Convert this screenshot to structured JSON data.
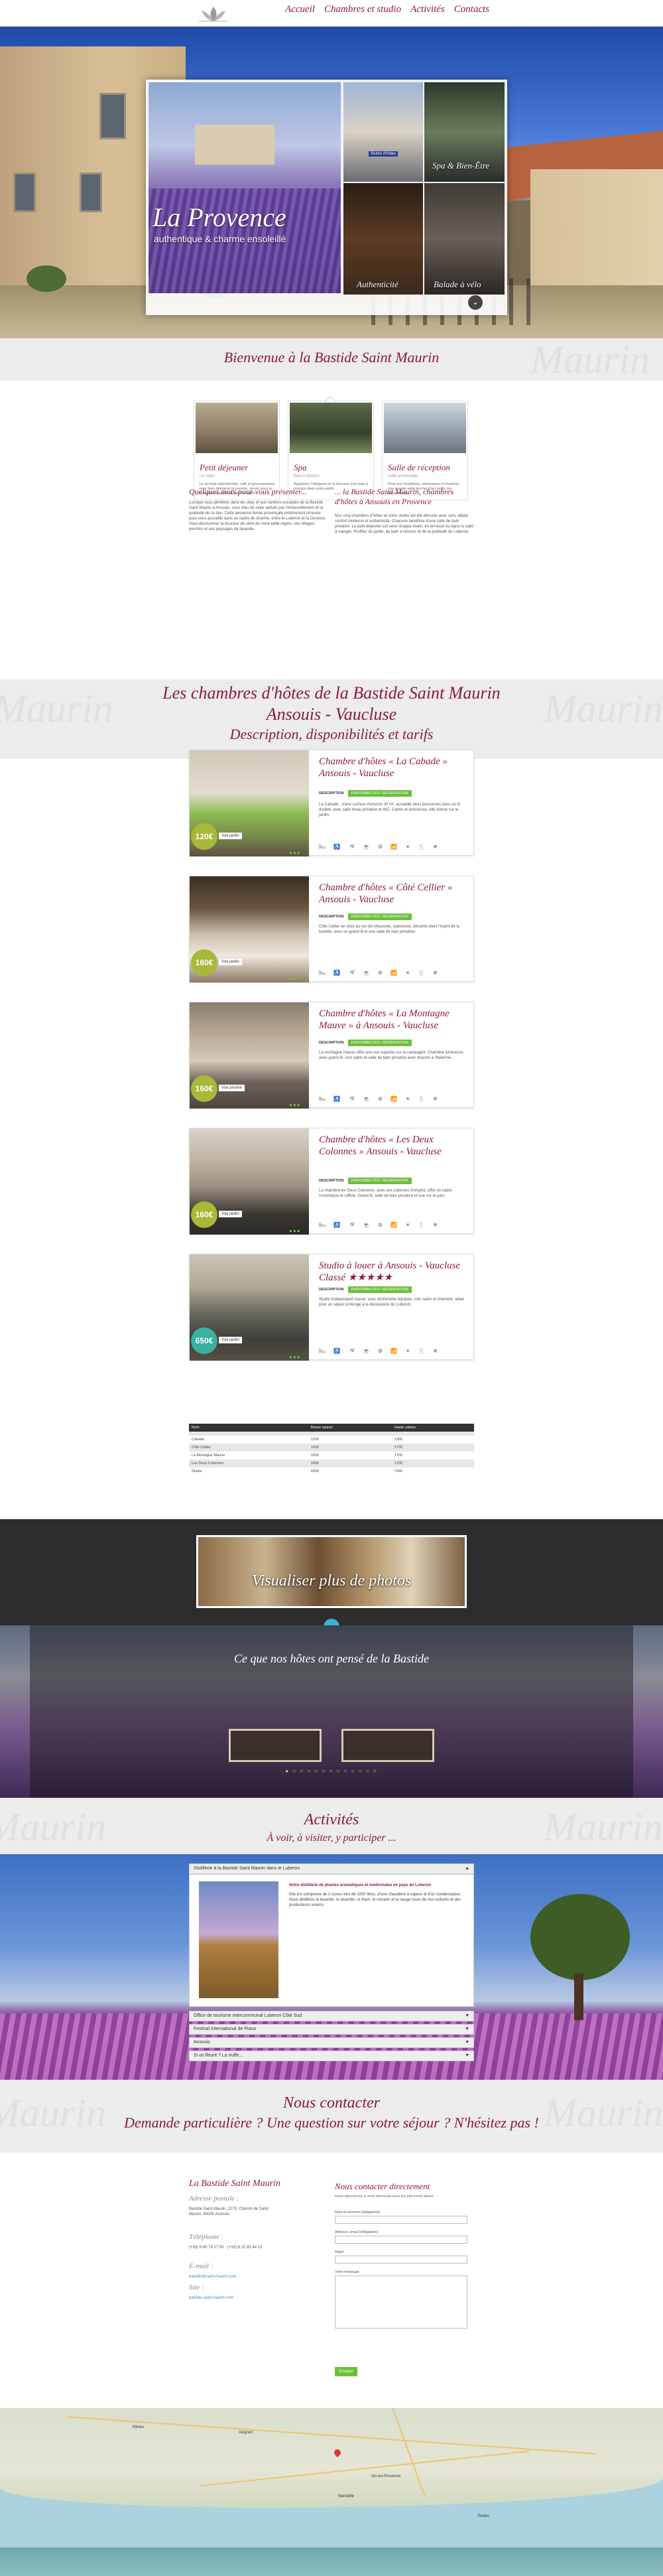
{
  "nav": {
    "items": [
      "Accueil",
      "Chambres et studio",
      "Activités",
      "Contacts"
    ]
  },
  "hero": {
    "title": "La Provence",
    "subtitle": "authentique & charme ensoleillé",
    "thumb1_tag": "Studio d'hôtes",
    "thumb2_label": "Spa & Bien-Être",
    "thumb3_label": "Authenticité",
    "thumb4_label": "Balade à vélo"
  },
  "welcome": {
    "title": "Bienvenue à la Bastide Saint Maurin",
    "watermark": "Maurin"
  },
  "services": [
    {
      "title": "Petit déjeuner",
      "sub": "Le matin",
      "desc": "Le du frais sélectionnés, café et gourmandises pour bien démarrer la journée, servis sous la tonnelle du jardin ou dans le salon."
    },
    {
      "title": "Spa",
      "sub": "Bain à remous",
      "desc": "Appréciez l'élégance et la douceur d'un bain à remous dans notre jardin."
    },
    {
      "title": "Salle de réception",
      "sub": "Salle privatisable",
      "desc": "Pour vos réceptions, séminaires et réunions, une grande salle permet d'accueillir vos évènements."
    }
  ],
  "intro": {
    "left_title": "Quelques mots pour vous présenter...",
    "left_text": "Lorsque vous pénétrez dans les sites et aux sentiers escarpés de la Bastide Saint Maurin à Ansouis, vous êtes de suite séduits par l'émerveillement et la quiétude de ce lieu. Cette ancienne ferme provençale entièrement rénovée pour vous accueillir dans un cadre de charme, entre le Luberon et la Durance. Vous découvrirez la douceur de vivre de notre belle région, ses villages perchés et ses paysages de lavande.",
    "right_title": "... la Bastide Saint Maurin, chambres d'hôtes à Ansouis en Provence",
    "right_text": "Nos cinq chambres d'hôtes et notre studio ont été décorés avec soin, alliant confort moderne et authenticité. Chacune bénéficie d'une salle de bain privative. Le petit déjeuner est servi chaque matin, en terrasse ou dans la salle à manger. Profitez du jardin, du bain à remous et de la quiétude du Luberon."
  },
  "rooms_band": {
    "line1": "Les chambres d'hôtes de la Bastide Saint Maurin",
    "line2": "Ansouis - Vaucluse",
    "line3": "Description, disponibilités et tarifs"
  },
  "rooms": [
    {
      "title": "Chambre d'hôtes « La Cabade » Ansouis - Vaucluse",
      "price": "120€",
      "caption": "Vue jardin",
      "desc_label": "DESCRIPTION",
      "dispo_label": "DISPONIBILITÉS / RÉSERVATION",
      "desc": "La Cabade : d'une surface d'environ 20 m², accueille deux personnes dans un lit double, avec salle d'eau privative et WC. Calme et lumineuse, elle donne sur le jardin."
    },
    {
      "title": "Chambre d'hôtes « Côté Cellier » Ansouis - Vaucluse",
      "price": "160€",
      "caption": "Vue jardin",
      "desc_label": "DESCRIPTION",
      "dispo_label": "DISPONIBILITÉS / RÉSERVATION",
      "desc": "Côté Cellier se situe au rez-de-chaussée, spacieuse, décorée dans l'esprit de la bastide, avec un grand lit et une salle de bain privative."
    },
    {
      "title": "Chambre d'hôtes « La Montagne Mauve » à Ansouis - Vaucluse",
      "price": "160€",
      "caption": "Vue piscine",
      "desc_label": "DESCRIPTION",
      "dispo_label": "DISPONIBILITÉS / RÉSERVATION",
      "desc": "La montagne mauve offre une vue superbe sur la campagne. Chambre lumineuse avec grand lit, coin salon et salle de bain privative avec douche à l'italienne."
    },
    {
      "title": "Chambre d'hôtes « Les Deux Colonnes » Ansouis - Vaucluse",
      "price": "160€",
      "caption": "Vue jardin",
      "desc_label": "DESCRIPTION",
      "dispo_label": "DISPONIBILITÉS / RÉSERVATION",
      "desc": "La chambre les Deux Colonnes, avec ses colonnes d'origine, offre un cadre romantique et raffiné. Grand lit, salle de bain privative et vue sur le parc."
    },
    {
      "title": "Studio à louer à Ansouis - Vaucluse Classé ★★★★★",
      "price": "650€",
      "caption": "Vue jardin",
      "desc_label": "DESCRIPTION",
      "dispo_label": "DISPONIBILITÉS / RÉSERVATION",
      "desc": "Studio indépendant classé, avec kitchenette équipée, coin salon et chambre. Idéal pour un séjour prolongé à la découverte du Luberon."
    }
  ],
  "tarifs": {
    "headers": [
      "Nom",
      "Basse saison",
      "Haute saison"
    ],
    "rows": [
      [
        "",
        "",
        ""
      ],
      [
        "Cabade",
        "120€",
        "130€"
      ],
      [
        "Côté Cellier",
        "160€",
        "170€"
      ],
      [
        "La Montagne Mauve",
        "160€",
        "170€"
      ],
      [
        "Les Deux Colonnes",
        "160€",
        "170€"
      ],
      [
        "Studio",
        "650€",
        "700€"
      ]
    ]
  },
  "gallery": {
    "caption": "Visualiser plus de photos"
  },
  "testimonials": {
    "title": "Ce que nos hôtes ont pensé de la Bastide"
  },
  "activities_band": {
    "line1": "Activités",
    "line2": "À voir, à visiter, y participer ..."
  },
  "activities": {
    "open_item": "Distillerie à la Bastide Saint Maurin dans le Luberon",
    "body_title": "Notre distillerie de plantes aromatiques et médicinales en pays du Luberon",
    "body_text": "Elle est composée de 2 cuves inox de 1000 litres, d'une chaudière à vapeur et d'un condensateur. Nous distillons la lavande, le lavandin, le thym, le romarin et la sauge issus de nos cultures et des producteurs voisins.",
    "items": [
      "Office de tourisme intercommunal Luberon Côté Sud",
      "Festival International de Piano",
      "Ansouis",
      "Si on fleurit ? La truffe..."
    ]
  },
  "contact_band": {
    "line1": "Nous contacter",
    "line2": "Demande particulière ? Une question sur votre séjour ? N'hésitez pas !"
  },
  "contact": {
    "brand": "La Bastide Saint Maurin",
    "address_label": "Adresse postale :",
    "address": "Bastide Saint Maurin, 1270, Chemin de Saint Maurin, 84240 Ansouis",
    "phone_label": "Téléphone :",
    "phones": "(+33) 6 60 78 17 50 · (+33) 6 22 85 44 10",
    "email_label": "E-mail :",
    "email": "bastide@saint-maurin.com",
    "site_label": "Site :",
    "site": "bastide-saint-maurin.com",
    "form_title": "Nous contacter directement",
    "form_intro": "Nous répondrons à votre demande dans les plus brefs délais.",
    "name_label": "Nom et prénom (obligatoire)",
    "email_field_label": "Adresse email (obligatoire)",
    "subject_label": "Objet",
    "message_label": "Votre message",
    "send": "Envoyer"
  },
  "map": {
    "cities": [
      "Avignon",
      "Aix-en-Provence",
      "Marseille",
      "Toulon",
      "Nîmes"
    ]
  }
}
